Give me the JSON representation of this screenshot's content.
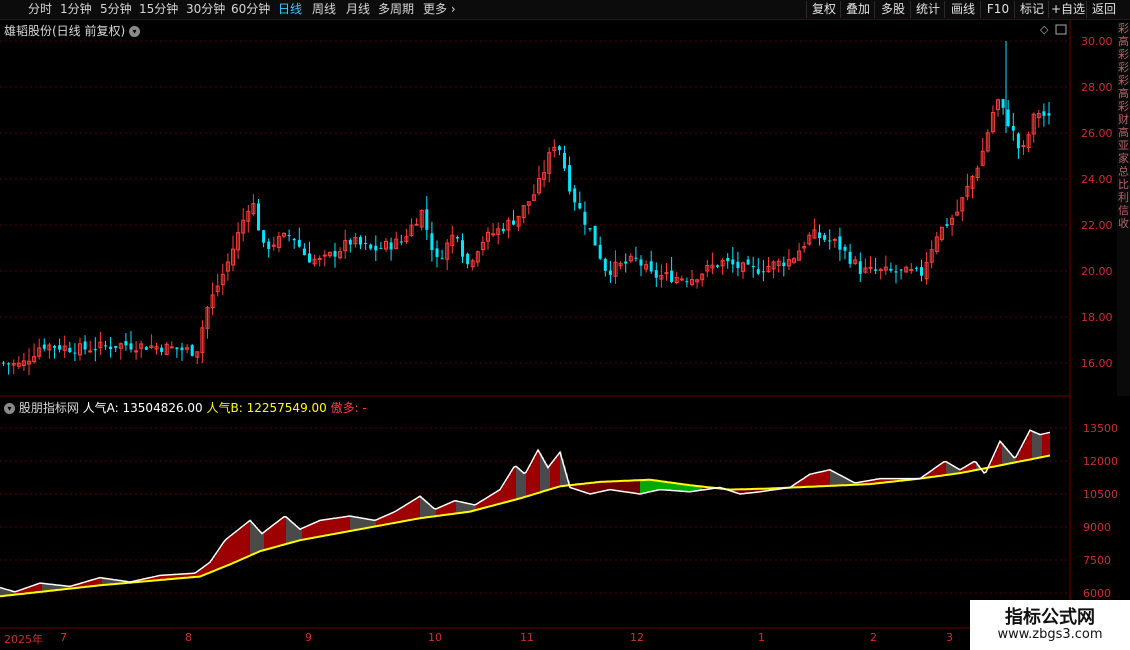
{
  "toolbar": {
    "periods": [
      "分时",
      "1分钟",
      "5分钟",
      "15分钟",
      "30分钟",
      "60分钟",
      "日线",
      "周线",
      "月线",
      "多周期",
      "更多"
    ],
    "active_period": "日线",
    "right_buttons": [
      "复权",
      "叠加",
      "多股",
      "统计",
      "画线",
      "F10",
      "标记",
      "+自选",
      "返回"
    ]
  },
  "main_panel": {
    "title": "雄韬股份(日线 前复权)",
    "price_axis_ticks": [
      "30.00",
      "28.00",
      "26.00",
      "24.00",
      "22.00",
      "20.00",
      "18.00",
      "16.00"
    ]
  },
  "indicator": {
    "name": "股朋指标网",
    "label_a": "人气A: 13504826.00",
    "label_b": "人气B: 12257549.00",
    "label_c": "傲多: -",
    "axis_ticks": [
      "13500",
      "12000",
      "10500",
      "9000",
      "7500",
      "6000"
    ]
  },
  "x_axis": [
    "2025年",
    "7",
    "8",
    "9",
    "10",
    "11",
    "12",
    "1",
    "2",
    "3"
  ],
  "watermark": {
    "title": "指标公式网",
    "url": "www.zbgs3.com"
  },
  "colors": {
    "up": "#ff3c3c",
    "down": "#00e6ff",
    "line_a": "#ffffff",
    "line_b": "#ffff00",
    "fill_red": "#9c0000",
    "fill_gray": "#4a4a4a",
    "fill_green": "#00aa00",
    "grid": "#5a0000",
    "axis_text": "#cc3030"
  },
  "right_strip_chars": "彩高彩彩彩高彩财高亚家总比利信收"
}
